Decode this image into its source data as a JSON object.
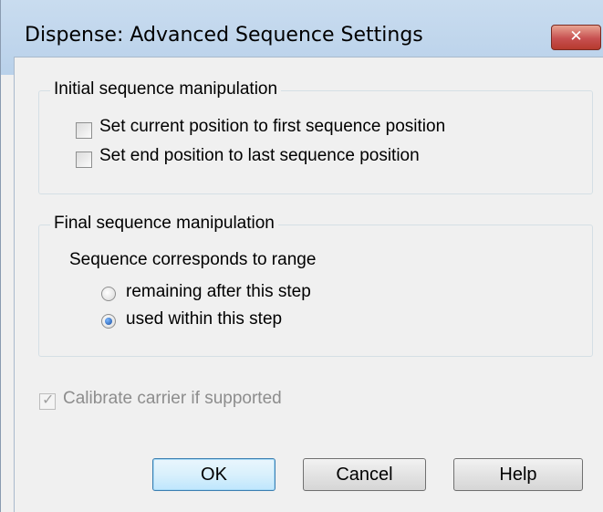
{
  "window": {
    "title": "Dispense: Advanced Sequence Settings",
    "close_glyph": "✕"
  },
  "initial_group": {
    "title": "Initial sequence manipulation",
    "options": [
      {
        "label": "Set current position to first sequence position",
        "checked": false
      },
      {
        "label": "Set end position to last sequence position",
        "checked": false
      }
    ]
  },
  "final_group": {
    "title": "Final sequence manipulation",
    "prompt": "Sequence corresponds to range",
    "options": [
      {
        "label": "remaining after this step",
        "selected": false
      },
      {
        "label": "used within this step",
        "selected": true
      }
    ]
  },
  "calibrate": {
    "label": "Calibrate carrier if supported",
    "checked": true,
    "enabled": false,
    "check_glyph": "✓"
  },
  "buttons": {
    "ok": "OK",
    "cancel": "Cancel",
    "help": "Help"
  }
}
